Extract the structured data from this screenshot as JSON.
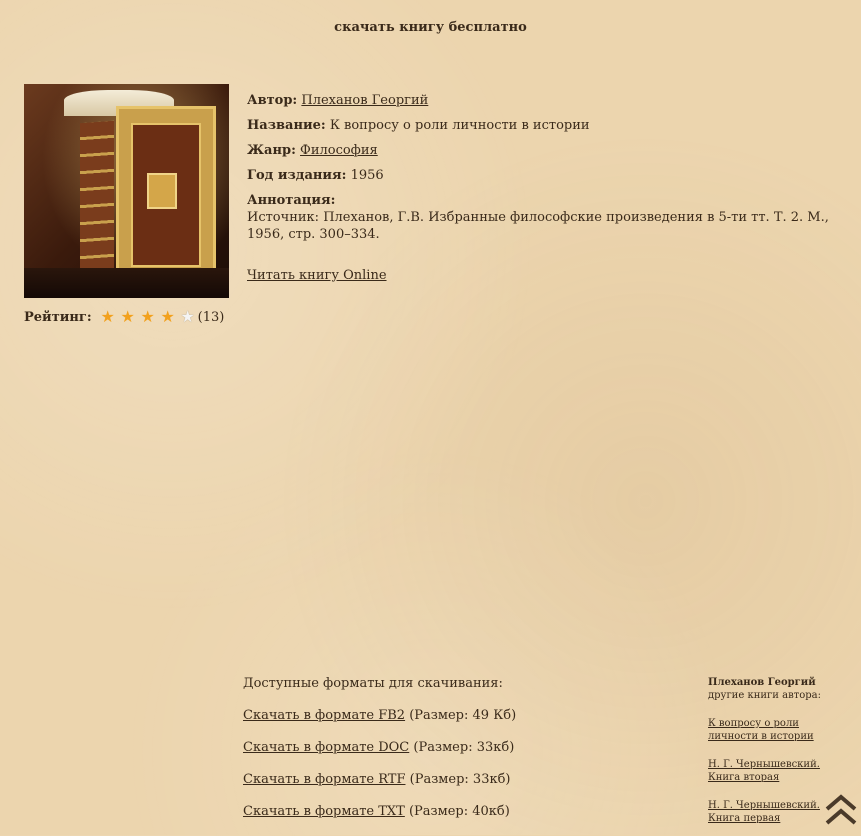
{
  "page": {
    "title": "скачать книгу бесплатно"
  },
  "book": {
    "author_label": "Автор:",
    "author": "Плеханов Георгий",
    "title_label": "Название:",
    "title": "К вопросу о роли личности в истории",
    "genre_label": "Жанр:",
    "genre": "Философия",
    "year_label": "Год издания:",
    "year": "1956",
    "annotation_label": "Аннотация:",
    "annotation": "Источник: Плеханов, Г.В. Избранные философские произведения в 5-ти тт. Т. 2. М., 1956, стр. 300–334.",
    "read_online": "Читать книгу Online"
  },
  "rating": {
    "label": "Рейтинг:",
    "value": 4,
    "max": 5,
    "count": "(13)"
  },
  "formats": {
    "heading": "Доступные форматы для скачивания:",
    "items": [
      {
        "link": "Скачать в формате FB2",
        "size": "(Размер: 49 Кб)"
      },
      {
        "link": "Скачать в формате DOC",
        "size": "(Размер: 33кб)"
      },
      {
        "link": "Скачать в формате RTF",
        "size": "(Размер: 33кб)"
      },
      {
        "link": "Скачать в формате TXT",
        "size": "(Размер: 40кб)"
      }
    ]
  },
  "sidebar": {
    "author": "Плеханов Георгий",
    "subtitle": "другие книги автора:",
    "books": [
      "К вопросу о роли личности в истории",
      "Н. Г. Чернышевский. Книга вторая",
      "Н. Г. Чернышевский. Книга первая"
    ]
  },
  "icons": {
    "scroll_top": "double-chevron-up-icon",
    "star": "star-icon"
  },
  "colors": {
    "star_full": "#f2a11e",
    "star_empty": "#f4f4f4",
    "text": "#3a2a1a"
  }
}
